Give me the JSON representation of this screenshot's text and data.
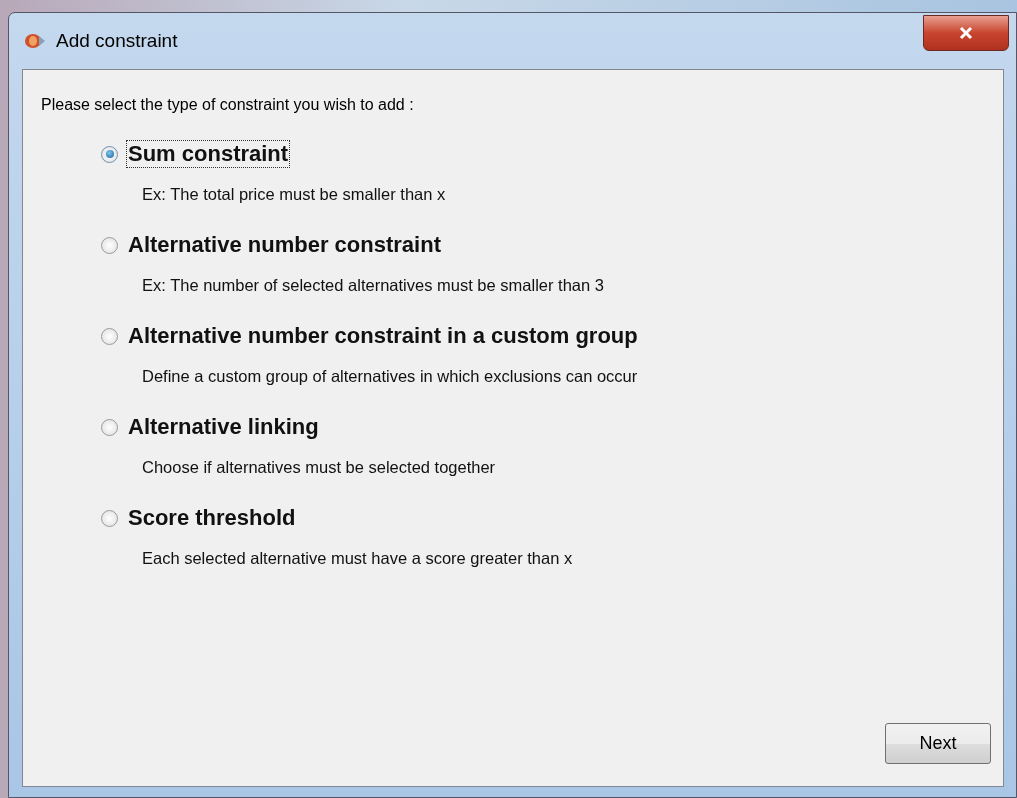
{
  "window": {
    "title": "Add constraint"
  },
  "prompt": "Please select the type of constraint you wish to add :",
  "options": [
    {
      "label": "Sum constraint",
      "description": "Ex: The total price must be smaller than x",
      "selected": true
    },
    {
      "label": "Alternative number constraint",
      "description": "Ex: The number of selected alternatives must be smaller than 3",
      "selected": false
    },
    {
      "label": "Alternative number constraint in a custom group",
      "description": "Define a custom group of alternatives in which exclusions can occur",
      "selected": false
    },
    {
      "label": "Alternative linking",
      "description": "Choose if alternatives must be selected together",
      "selected": false
    },
    {
      "label": "Score threshold",
      "description": "Each selected alternative must have a score greater than x",
      "selected": false
    }
  ],
  "buttons": [
    "Next"
  ]
}
